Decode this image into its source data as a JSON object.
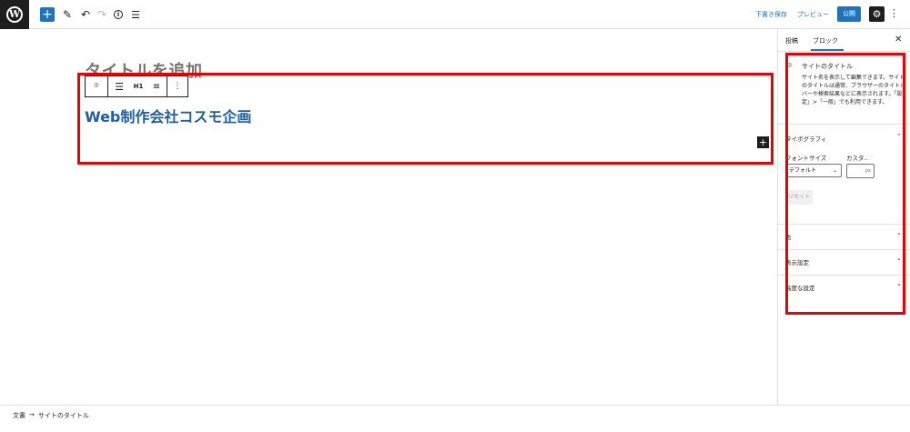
{
  "topbar": {
    "logo_letter": "W",
    "add_icon": "plus-icon",
    "tools_icon": "pencil-icon",
    "undo_icon": "undo-icon",
    "redo_icon": "redo-icon",
    "info_icon": "info-icon",
    "list_icon": "list-view-icon",
    "save_draft_label": "下書き保存",
    "preview_label": "プレビュー",
    "publish_label": "公開",
    "settings_icon": "gear-icon",
    "more_icon": "more-vertical-icon"
  },
  "editor": {
    "post_title": "タイトルを追加",
    "site_title": "Web制作会社コスモ企画",
    "toolbar": {
      "items": [
        "site-title-block-icon",
        "align-icon",
        "H1",
        "text-align-icon",
        "more-vertical-icon"
      ],
      "heading_level": "H1"
    }
  },
  "footer": {
    "breadcrumb": [
      "文書",
      "→",
      "サイトのタイトル"
    ]
  },
  "sidebar": {
    "tabs": [
      "投稿",
      "ブロック"
    ],
    "active_tab": "ブロック",
    "close_icon": "close-icon",
    "block_card": {
      "icon": "location-pin-icon",
      "title": "サイトのタイトル",
      "description": "サイト名を表示して編集できます。サイトのタイトルは通常、ブラウザーのタイトルバーや検索結果などに表示されます。「設定」>「一般」でも利用できます。"
    },
    "typography": {
      "title": "タイポグラフィ",
      "font_size_label": "フォントサイズ",
      "custom_label": "カスタ..",
      "select_value": "デフォルト",
      "unit": "px",
      "reset_label": "リセット"
    },
    "panels": [
      "色",
      "表示設定",
      "高度な設定"
    ]
  }
}
